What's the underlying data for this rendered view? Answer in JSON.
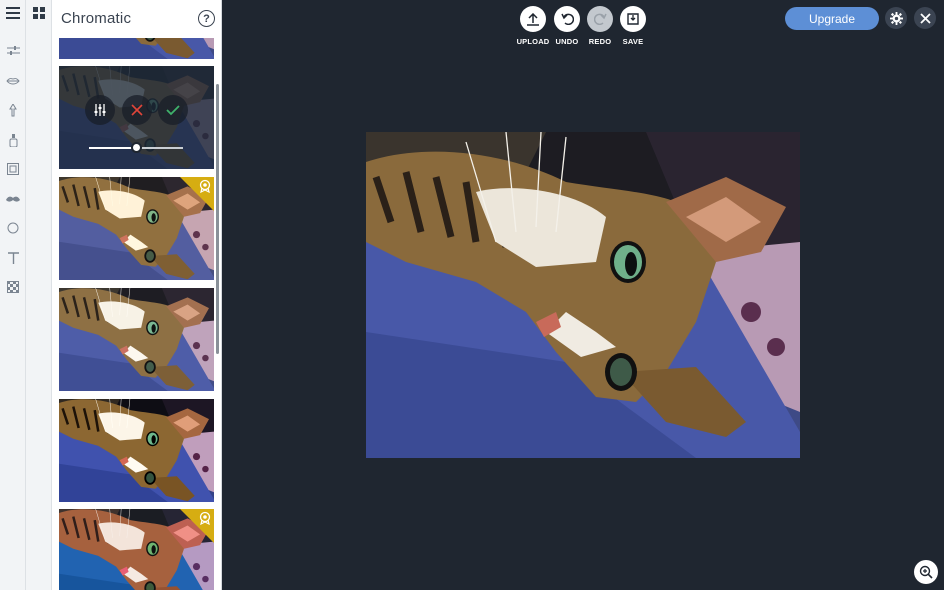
{
  "panel": {
    "title": "Chromatic",
    "help_label": "?"
  },
  "left_tools": [
    {
      "icon": "menu-icon"
    },
    {
      "icon": "adjust-sliders-icon"
    },
    {
      "icon": "lips-icon"
    },
    {
      "icon": "pin-icon"
    },
    {
      "icon": "bottle-icon"
    },
    {
      "icon": "frame-icon"
    },
    {
      "icon": "mustache-icon"
    },
    {
      "icon": "shape-icon"
    },
    {
      "icon": "text-icon"
    },
    {
      "icon": "texture-icon"
    }
  ],
  "toolbar": {
    "upload_label": "UPLOAD",
    "undo_label": "UNDO",
    "redo_label": "REDO",
    "save_label": "SAVE",
    "redo_enabled": false
  },
  "header": {
    "upgrade_label": "Upgrade"
  },
  "active_effect": {
    "intensity": 0.5
  },
  "thumbnails": [
    {
      "premium": false,
      "active": false
    },
    {
      "premium": false,
      "active": true
    },
    {
      "premium": true,
      "active": false
    },
    {
      "premium": false,
      "active": false
    },
    {
      "premium": false,
      "active": false
    },
    {
      "premium": true,
      "active": false
    }
  ],
  "colors": {
    "accent": "#5d8fd6",
    "premium": "#d6ad12",
    "workspace": "#1f2630",
    "cancel": "#e0453a",
    "confirm": "#3fb26b"
  }
}
